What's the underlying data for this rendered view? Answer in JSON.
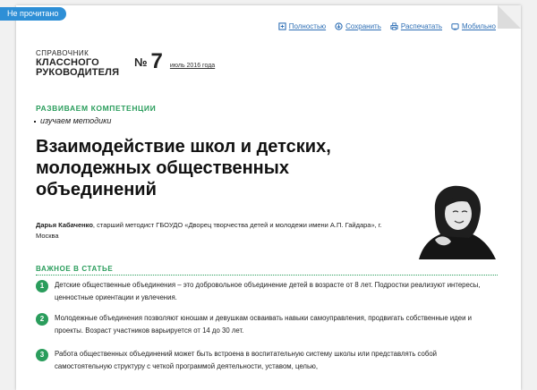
{
  "badge": {
    "unread": "Не прочитано"
  },
  "toolbar": {
    "items": [
      {
        "label": "Полностью",
        "icon": "fullscreen-icon"
      },
      {
        "label": "Сохранить",
        "icon": "save-icon"
      },
      {
        "label": "Распечатать",
        "icon": "print-icon"
      },
      {
        "label": "Мобильно",
        "icon": "mobile-icon"
      }
    ]
  },
  "journal": {
    "line1": "СПРАВОЧНИК",
    "line2": "КЛАССНОГО",
    "line3": "РУКОВОДИТЕЛЯ",
    "issue_prefix": "№",
    "issue_number": "7",
    "issue_date": "июль 2016 года"
  },
  "article": {
    "rubric": "РАЗВИВАЕМ КОМПЕТЕНЦИИ",
    "subrubric": "изучаем методики",
    "title": "Взаимодействие школ и детских, молодежных общественных объединений",
    "author_name": "Дарья Кабаченко",
    "author_info": ", старший методист ГБОУДО «Дворец творчества детей и молодежи имени А.П. Гайдара», г. Москва",
    "section_title": "ВАЖНОЕ В СТАТЬЕ",
    "points": [
      {
        "num": "1",
        "text": "Детские общественные объединения – это добровольное объединение детей в возрасте от 8 лет. Подростки реализуют интересы, ценностные ориентации и увлечения."
      },
      {
        "num": "2",
        "text": "Молодежные объединения позволяют юношам и девушкам осваивать навыки самоуправления, продвигать собственные идеи и проекты. Возраст участников варьируется от 14 до 30 лет."
      },
      {
        "num": "3",
        "text": "Работа общественных объединений может быть встроена в воспитательную систему школы или представлять собой самостоятельную структуру с четкой программой деятельности, уставом, целью,"
      }
    ]
  }
}
